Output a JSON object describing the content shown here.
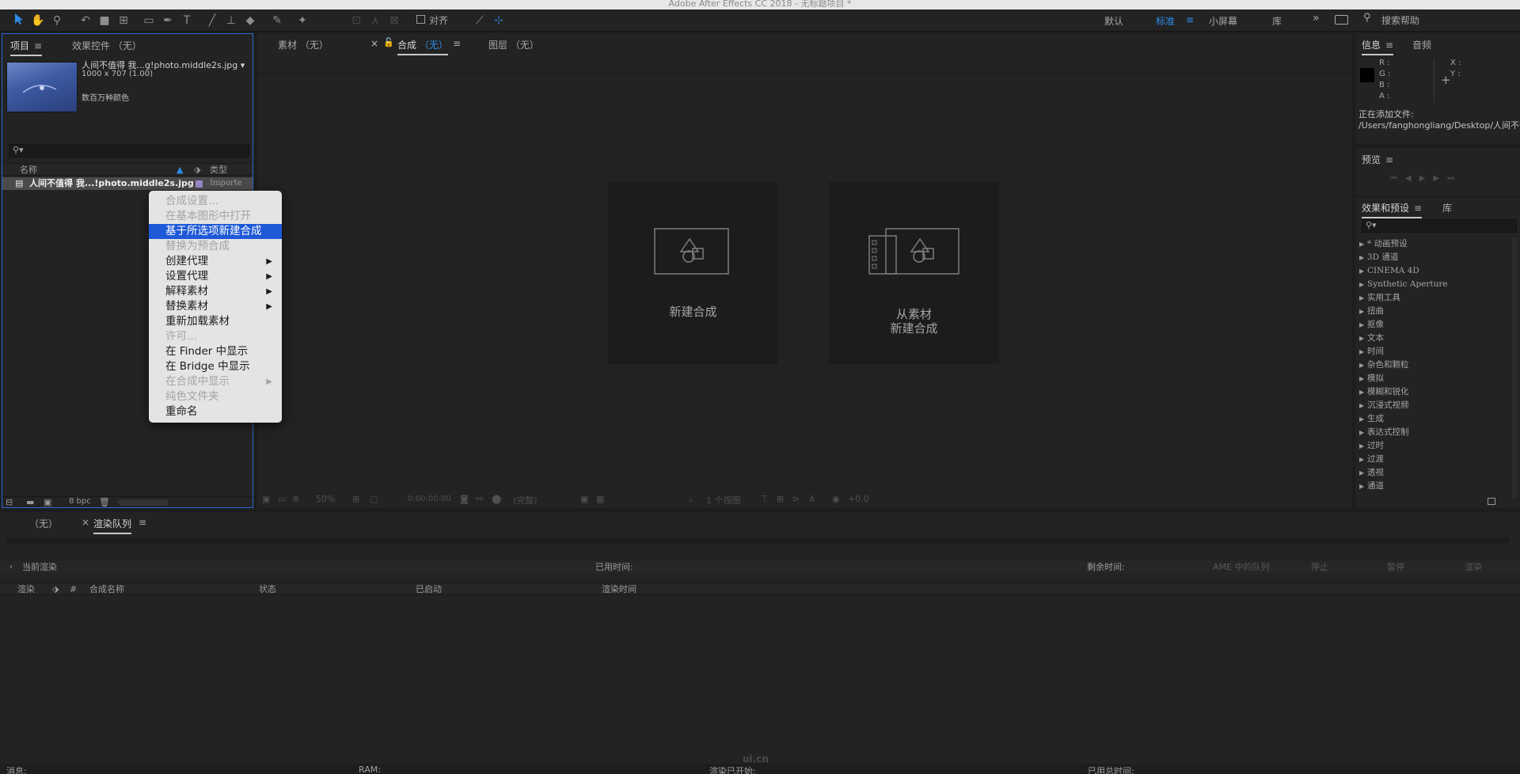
{
  "app": {
    "title": "Adobe After Effects CC 2018 - 无标题项目 *"
  },
  "toolbar": {
    "align_label": "对齐",
    "workspaces": [
      "默认",
      "标准",
      "小屏幕",
      "库"
    ],
    "active_workspace": "标准",
    "search_placeholder": "搜索帮助"
  },
  "project_panel": {
    "tabs": [
      "项目",
      "效果控件 （无）"
    ],
    "footage": {
      "name": "人间不值得 我...g!photo.middle2s.jpg ▾",
      "dims": "1000 x 707 (1.00)",
      "colors": "数百万种颜色"
    },
    "columns": {
      "name": "名称",
      "type": "类型"
    },
    "row": {
      "name": "人间不值得 我...!photo.middle2s.jpg",
      "type": "Importe"
    },
    "footer": {
      "bpc": "8 bpc"
    }
  },
  "context_menu": {
    "items": [
      {
        "label": "合成设置...",
        "state": "disabled",
        "submenu": false
      },
      {
        "label": "在基本图形中打开",
        "state": "disabled",
        "submenu": false
      },
      {
        "label": "基于所选项新建合成",
        "state": "highlighted",
        "submenu": false
      },
      {
        "label": "替换为预合成",
        "state": "disabled",
        "submenu": false
      },
      {
        "label": "创建代理",
        "state": "enabled",
        "submenu": true
      },
      {
        "label": "设置代理",
        "state": "enabled",
        "submenu": true
      },
      {
        "label": "解释素材",
        "state": "enabled",
        "submenu": true
      },
      {
        "label": "替换素材",
        "state": "enabled",
        "submenu": true
      },
      {
        "label": "重新加载素材",
        "state": "enabled",
        "submenu": false
      },
      {
        "label": "许可...",
        "state": "disabled",
        "submenu": false
      },
      {
        "label": "在 Finder 中显示",
        "state": "enabled",
        "submenu": false
      },
      {
        "label": "在 Bridge 中显示",
        "state": "enabled",
        "submenu": false
      },
      {
        "label": "在合成中显示",
        "state": "disabled",
        "submenu": true
      },
      {
        "label": "纯色文件夹",
        "state": "disabled",
        "submenu": false
      },
      {
        "label": "重命名",
        "state": "enabled",
        "submenu": false
      }
    ]
  },
  "comp_panel": {
    "tabs": {
      "footage": "素材 （无）",
      "comp_prefix": "合成",
      "comp_suffix": "（无）",
      "layer": "图层 （无）"
    },
    "cards": {
      "new_comp": "新建合成",
      "from_footage_1": "从素材",
      "from_footage_2": "新建合成"
    },
    "footer": {
      "zoom": "50%",
      "time": "0:00:00:00",
      "quality": "(完整)",
      "views": "1 个视图",
      "exposure": "+0.0"
    }
  },
  "info_panel": {
    "tabs": [
      "信息",
      "音频"
    ],
    "r": "R :",
    "g": "G :",
    "b": "B :",
    "a": "A :",
    "x": "X :",
    "y": "Y :",
    "adding_label": "正在添加文件:",
    "path": "/Users/fanghongliang/Desktop/人间不值"
  },
  "preview_panel": {
    "title": "预览"
  },
  "effects_panel": {
    "tabs": [
      "效果和预设",
      "库"
    ],
    "items": [
      "* 动画预设",
      "3D 通道",
      "CINEMA 4D",
      "Synthetic Aperture",
      "实用工具",
      "扭曲",
      "抠像",
      "文本",
      "时间",
      "杂色和颗粒",
      "模拟",
      "模糊和锐化",
      "沉浸式视频",
      "生成",
      "表达式控制",
      "过时",
      "过渡",
      "透视",
      "通道"
    ]
  },
  "render_panel": {
    "tabs": [
      "（无）",
      "渲染队列"
    ],
    "current_render": "当前渲染",
    "elapsed": "已用时间:",
    "remaining": "剩余时间:",
    "buttons": [
      "AME 中的队列",
      "停止",
      "暂停",
      "渲染"
    ],
    "columns": [
      "渲染",
      "#",
      "合成名称",
      "状态",
      "已启动",
      "渲染时间"
    ]
  },
  "status_bar": {
    "msg": "消息:",
    "ram": "RAM:",
    "render_start": "渲染已开始:",
    "total_time": "已用总时间:"
  },
  "watermark": "ui.cn"
}
